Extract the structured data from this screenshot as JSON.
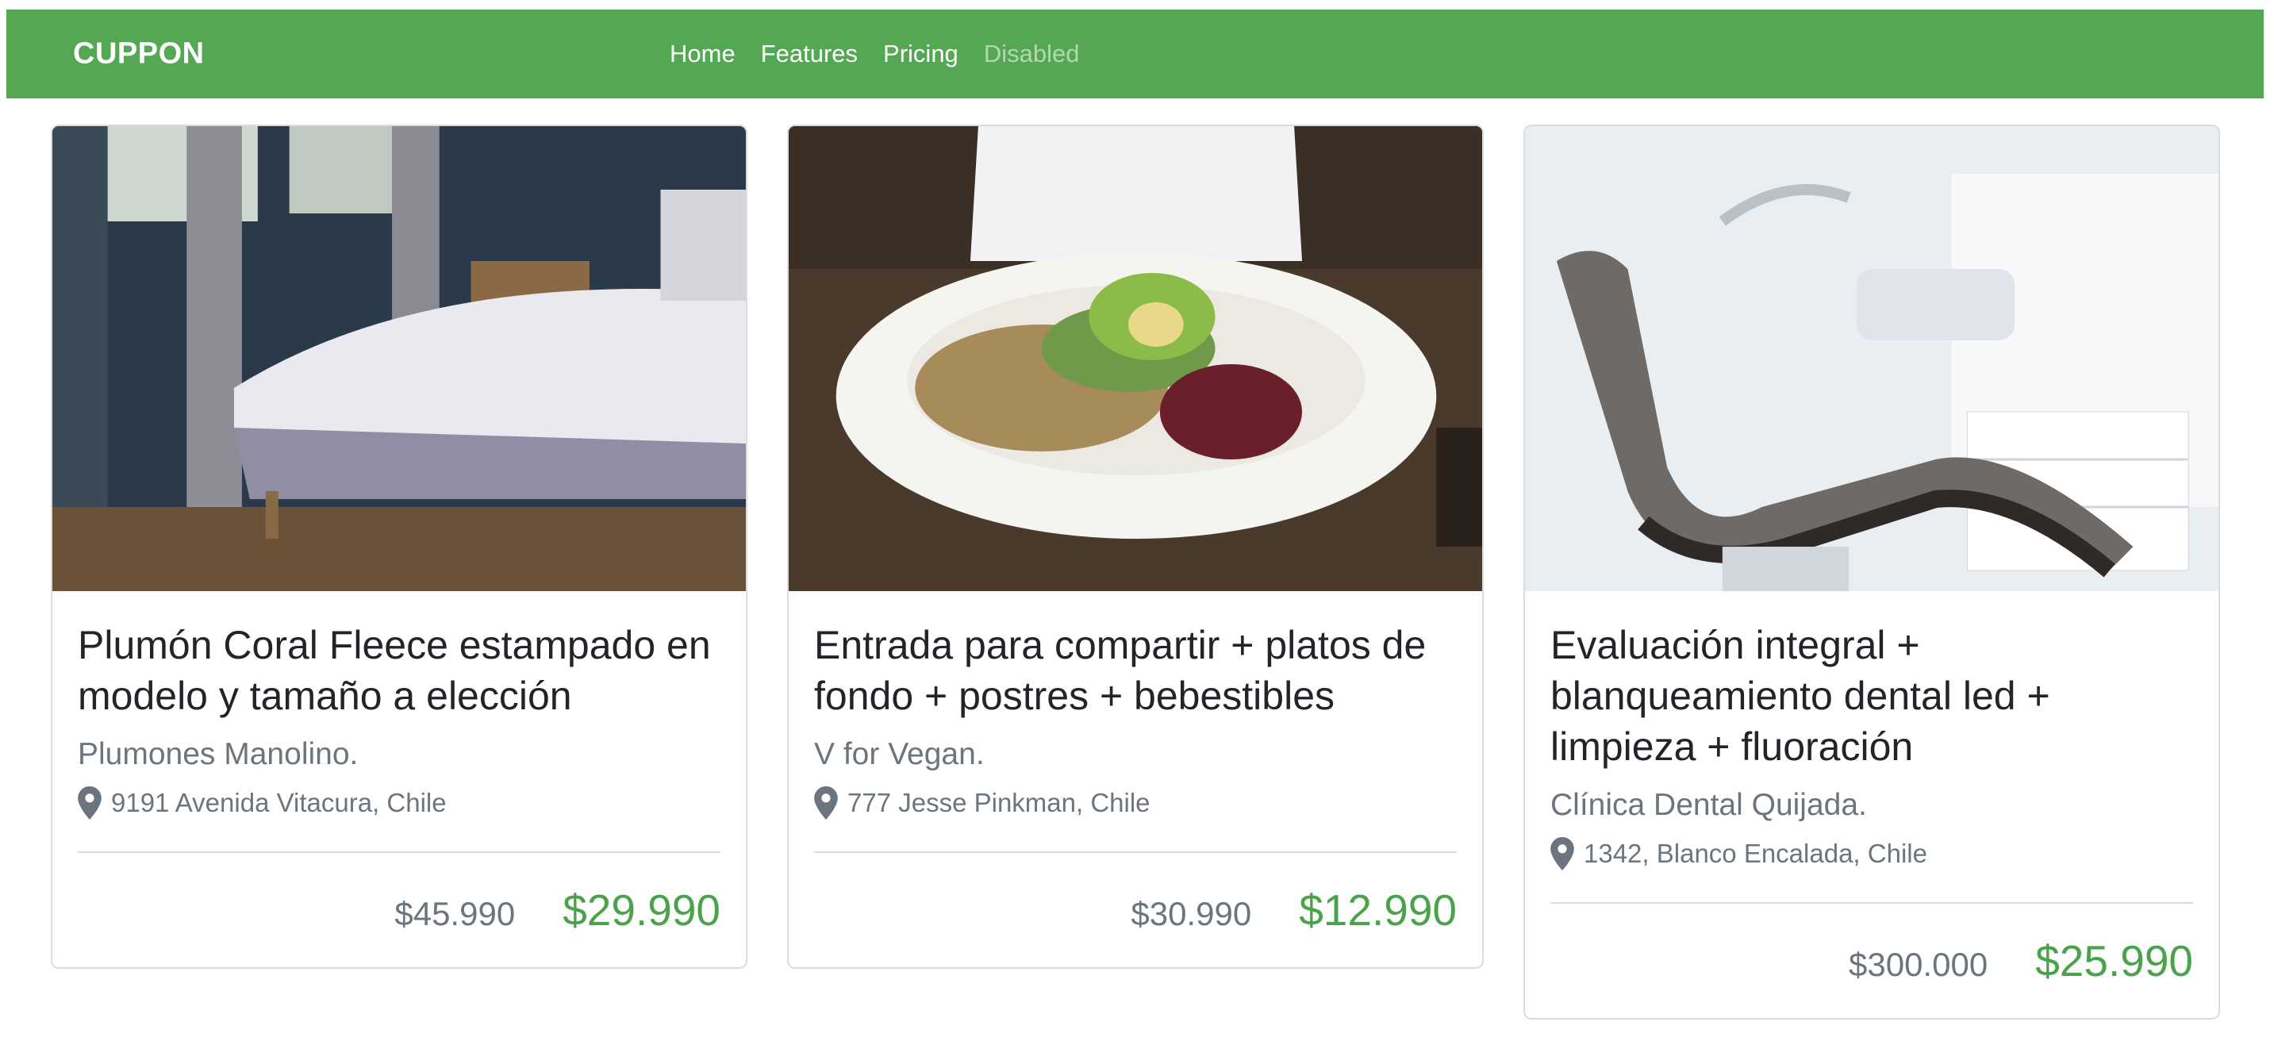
{
  "navbar": {
    "brand": "CUPPON",
    "links": [
      {
        "label": "Home",
        "disabled": false
      },
      {
        "label": "Features",
        "disabled": false
      },
      {
        "label": "Pricing",
        "disabled": false
      },
      {
        "label": "Disabled",
        "disabled": true
      }
    ],
    "bg_color": "#54a753"
  },
  "cards": [
    {
      "image_icon": "bedroom-photo",
      "title": "Plumón Coral Fleece estampado en modelo y tamaño a elección",
      "seller": "Plumones Manolino.",
      "location": "9191 Avenida Vitacura, Chile",
      "old_price": "$45.990",
      "new_price": "$29.990"
    },
    {
      "image_icon": "vegan-food-photo",
      "title": "Entrada para compartir + platos de fondo + postres + bebestibles",
      "seller": "V for Vegan.",
      "location": "777 Jesse Pinkman, Chile",
      "old_price": "$30.990",
      "new_price": "$12.990"
    },
    {
      "image_icon": "dental-clinic-photo",
      "title": "Evaluación integral + blanqueamiento dental led + limpieza + fluoración",
      "seller": "Clínica Dental Quijada.",
      "location": "1342, Blanco Encalada, Chile",
      "old_price": "$300.000",
      "new_price": "$25.990"
    }
  ],
  "colors": {
    "accent_green": "#54a753",
    "price_green": "#4aa34a",
    "muted_text": "#6c757d"
  }
}
